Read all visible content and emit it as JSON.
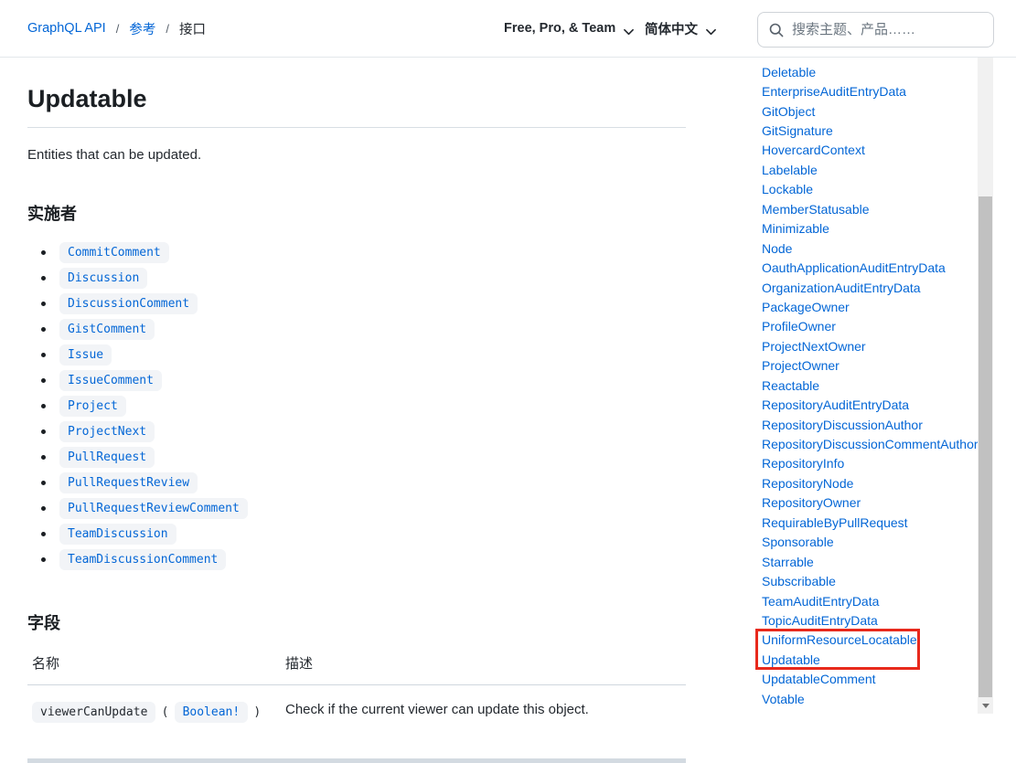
{
  "header": {
    "breadcrumb": [
      {
        "label": "GraphQL API",
        "sep": "/"
      },
      {
        "label": "参考",
        "sep": "/"
      },
      {
        "label": "接口",
        "sep": ""
      }
    ],
    "plan_selector": "Free, Pro, & Team",
    "language_selector": "简体中文",
    "search_placeholder": "搜索主题、产品……"
  },
  "main": {
    "title": "Updatable",
    "description": "Entities that can be updated.",
    "implementers": {
      "heading": "实施者",
      "items": [
        "CommitComment",
        "Discussion",
        "DiscussionComment",
        "GistComment",
        "Issue",
        "IssueComment",
        "Project",
        "ProjectNext",
        "PullRequest",
        "PullRequestReview",
        "PullRequestReviewComment",
        "TeamDiscussion",
        "TeamDiscussionComment"
      ]
    },
    "fields": {
      "heading": "字段",
      "columns": [
        "名称",
        "描述"
      ],
      "rows": [
        {
          "name": "viewerCanUpdate",
          "paren_open": "(",
          "type": "Boolean!",
          "paren_close": ")",
          "description": "Check if the current viewer can update this object."
        }
      ]
    }
  },
  "sidebar": {
    "items": [
      "Deletable",
      "EnterpriseAuditEntryData",
      "GitObject",
      "GitSignature",
      "HovercardContext",
      "Labelable",
      "Lockable",
      "MemberStatusable",
      "Minimizable",
      "Node",
      "OauthApplicationAuditEntryData",
      "OrganizationAuditEntryData",
      "PackageOwner",
      "ProfileOwner",
      "ProjectNextOwner",
      "ProjectOwner",
      "Reactable",
      "RepositoryAuditEntryData",
      "RepositoryDiscussionAuthor",
      "RepositoryDiscussionCommentAuthor",
      "RepositoryInfo",
      "RepositoryNode",
      "RepositoryOwner",
      "RequirableByPullRequest",
      "Sponsorable",
      "Starrable",
      "Subscribable",
      "TeamAuditEntryData",
      "TopicAuditEntryData",
      "UniformResourceLocatable",
      "Updatable",
      "UpdatableComment",
      "Votable"
    ],
    "highlighted_items": [
      "UniformResourceLocatable",
      "Updatable"
    ]
  },
  "icons": {
    "search": "magnifier",
    "plan_dropdown": "chevron-down",
    "language_dropdown": "chevron-down",
    "scrollbar_down": "triangle-down"
  },
  "colors": {
    "link_blue": "#0366d6",
    "text_dark": "#24292f",
    "highlight_red": "#e8291c",
    "chip_bg": "#f2f4f7",
    "scrollbar_thumb": "#c1c1c1",
    "scrollbar_track": "#f1f1f1"
  }
}
